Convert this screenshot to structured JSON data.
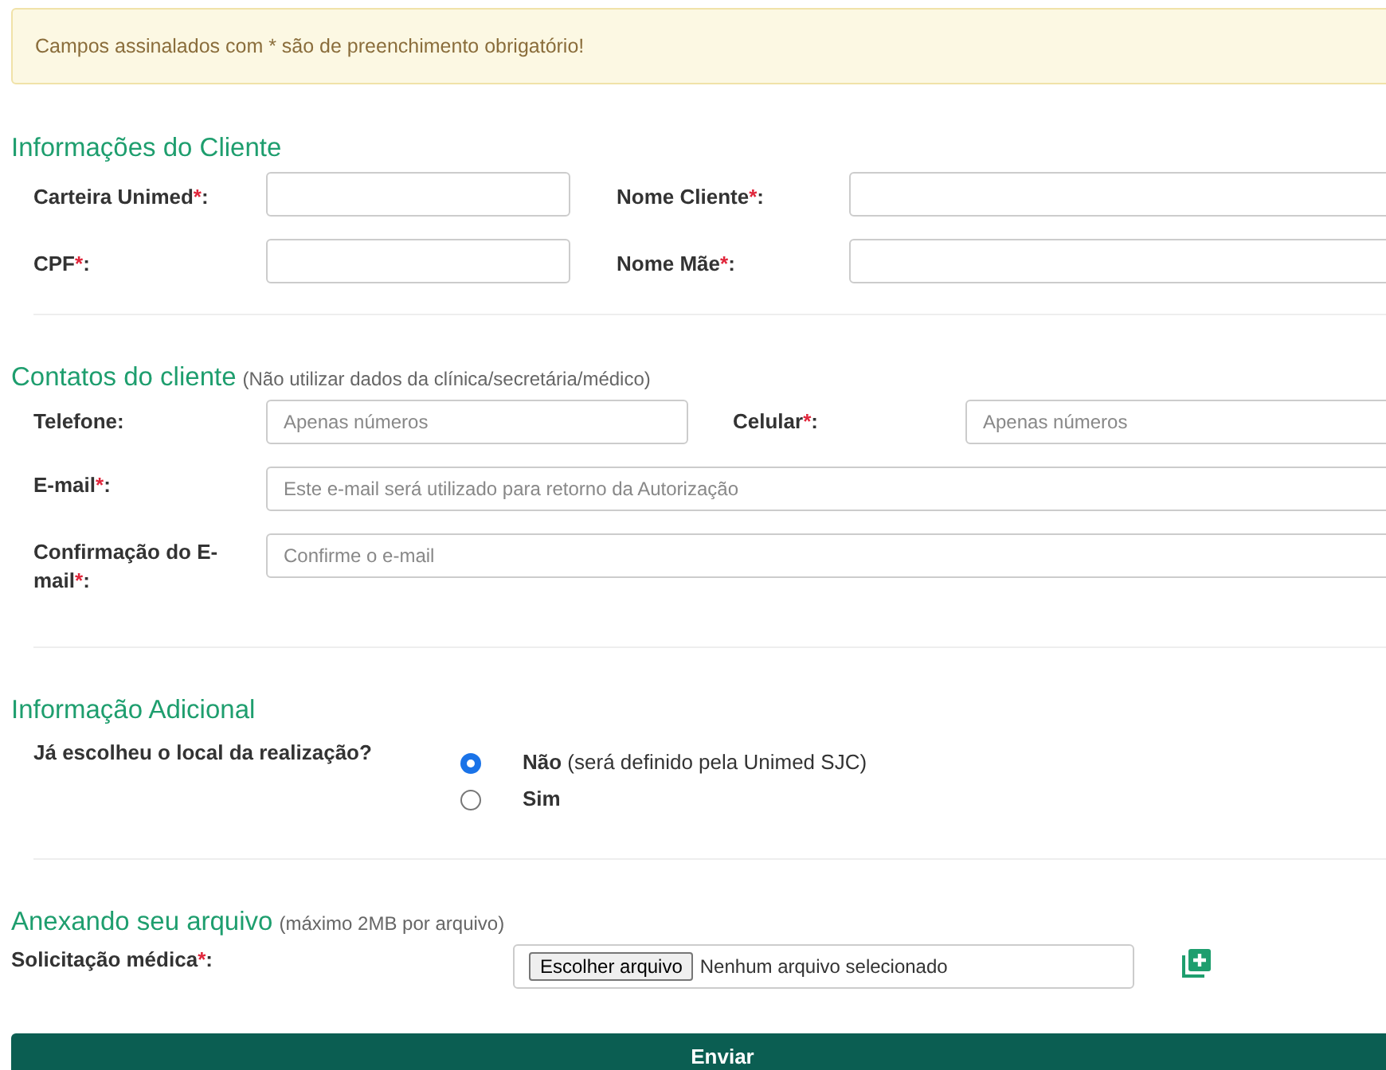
{
  "alert": {
    "text": "Campos assinalados com * são de preenchimento obrigatório!"
  },
  "client_info": {
    "title": "Informações do Cliente",
    "fields": [
      {
        "label": "Carteira Unimed",
        "required_mark": "*",
        "suffix": ":"
      },
      {
        "label": "Nome Cliente",
        "required_mark": "*",
        "suffix": ":"
      },
      {
        "label": "CPF",
        "required_mark": "*",
        "suffix": ":"
      },
      {
        "label": "Nome Mãe",
        "required_mark": "*",
        "suffix": ":"
      }
    ]
  },
  "contacts": {
    "title": "Contatos do cliente",
    "note": "(Não utilizar dados da clínica/secretária/médico)",
    "phones": [
      {
        "label": "Telefone",
        "suffix": ":",
        "placeholder": "Apenas números"
      },
      {
        "label": "Celular",
        "required_mark": "*",
        "suffix": ":",
        "placeholder": "Apenas números"
      }
    ],
    "emails": [
      {
        "label": "E-mail",
        "required_mark": "*",
        "suffix": ":",
        "placeholder": "Este e-mail será utilizado para retorno da Autorização"
      },
      {
        "label": "Confirmação do E-mail",
        "required_mark": "*",
        "suffix": ":",
        "placeholder": "Confirme o e-mail"
      }
    ]
  },
  "additional": {
    "title": "Informação Adicional",
    "question": "Já escolheu o local da realização?",
    "options": [
      {
        "label": "Não",
        "note": "(será definido pela Unimed SJC)",
        "selected": true
      },
      {
        "label": "Sim",
        "selected": false
      }
    ]
  },
  "attachment": {
    "title": "Anexando seu arquivo",
    "note": "(máximo 2MB por arquivo)",
    "label": "Solicitação médica",
    "required_mark": "*",
    "suffix": ":",
    "file_button": "Escolher arquivo",
    "file_status": "Nenhum arquivo selecionado"
  },
  "submit": "Enviar"
}
